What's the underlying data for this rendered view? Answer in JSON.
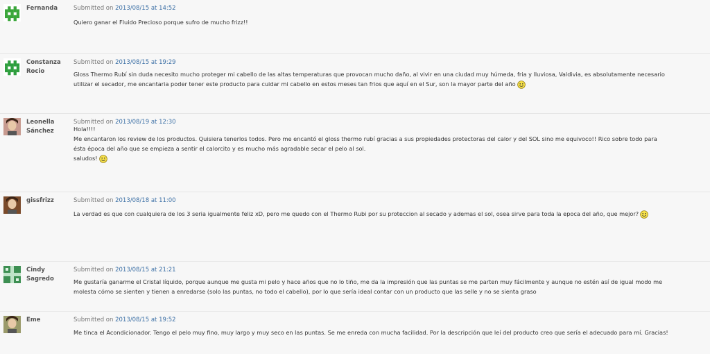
{
  "submitted_prefix": "Submitted on",
  "at_word": "at",
  "comments": [
    {
      "author": [
        "Fernanda",
        ""
      ],
      "date": "2013/08/15",
      "time": "14:52",
      "lines": [
        "Quiero ganar el Fluido Precioso porque sufro de mucho frizz!!"
      ],
      "avatar_type": "pixel-invader",
      "avatar_color": "#3aa63a"
    },
    {
      "author": [
        "Constanza",
        "Rocio"
      ],
      "date": "2013/08/15",
      "time": "19:29",
      "lines": [
        "Gloss Thermo Rubí sin duda necesito mucho proteger mi cabello de las altas temperaturas que provocan mucho daño, al vivir en una ciudad muy húmeda, fria y lluviosa, Valdivia, es absolutamente necesario",
        "utilizar el secador, me encantaria poder tener este producto para cuidar mi cabello en estos meses tan frios que aquí en el Sur, son la mayor parte del año"
      ],
      "smiley_after_line": 1,
      "avatar_type": "pixel-invader",
      "avatar_color": "#2e9e3e"
    },
    {
      "author": [
        "Leonella",
        "Sánchez"
      ],
      "date": "2013/08/19",
      "time": "12:30",
      "lines": [
        "Hola!!!!",
        "Me encantaron los review de los productos. Quisiera tenerlos todos. Pero me encantó el gloss thermo rubí gracias a sus propiedades protectoras del calor y del SOL sino me equivoco!! Rico sobre todo para",
        "ésta época del año que se empieza a sentir el calorcito y es mucho más agradable secar el pelo al sol.",
        "saludos!"
      ],
      "smiley_after_line": 3,
      "avatar_type": "photo",
      "avatar_color": "#c79a8f"
    },
    {
      "author": [
        "gissfrizz",
        ""
      ],
      "date": "2013/08/18",
      "time": "11:00",
      "lines": [
        "La verdad es que con cualquiera de los 3 seria igualmente feliz xD, pero me quedo con el Thermo Rubi por su proteccion al secado y ademas el sol, osea sirve para toda la epoca del año, que mejor?"
      ],
      "smiley_after_line": 0,
      "avatar_type": "photo",
      "avatar_color": "#7a4a2a"
    },
    {
      "author": [
        "Cindy",
        "Sagredo"
      ],
      "date": "2013/08/15",
      "time": "21:21",
      "lines": [
        "Me gustaría ganarme el Cristal líquido, porque aunque me gusta mi pelo y hace años que no lo tiño, me da la impresión que las puntas se me parten muy fácilmente y aunque no estén así de igual modo me",
        "molesta cómo se sienten y tienen a enredarse (solo las puntas, no todo el cabello), por lo que sería ideal contar con un producto que las selle y no se sienta graso"
      ],
      "avatar_type": "pixel-cross",
      "avatar_color": "#3d8f52"
    },
    {
      "author": [
        "Eme",
        ""
      ],
      "date": "2013/08/15",
      "time": "19:52",
      "lines": [
        "Me tinca el Acondicionador. Tengo el pelo muy fino, muy largo y muy seco en las puntas. Se me enreda con mucha facilidad. Por la descripción que leí del producto creo que sería el adecuado para mí. Gracias!"
      ],
      "avatar_type": "photo",
      "avatar_color": "#9a9a6a"
    }
  ]
}
